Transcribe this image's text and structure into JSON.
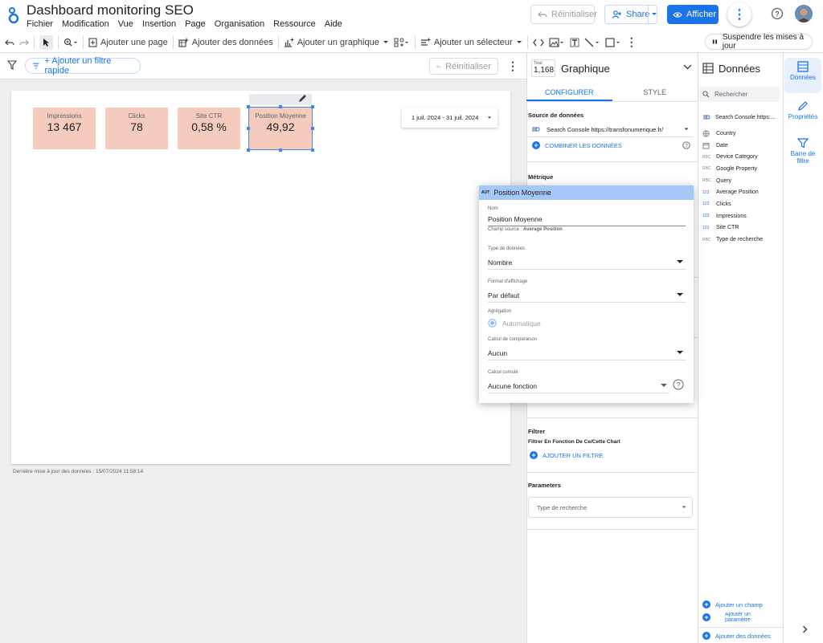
{
  "app": {
    "title": "Dashboard monitoring SEO",
    "menu": [
      "Fichier",
      "Modification",
      "Vue",
      "Insertion",
      "Page",
      "Organisation",
      "Ressource",
      "Aide"
    ],
    "reset_label": "Réinitialiser",
    "share_label": "Share",
    "view_label": "Afficher"
  },
  "toolbar": {
    "add_page": "Ajouter une page",
    "add_data": "Ajouter des données",
    "add_chart": "Ajouter un graphique",
    "add_selector": "Ajouter un sélecteur",
    "pause_updates": "Suspendre les mises à jour"
  },
  "filterbar": {
    "quick_filter": "+ Ajouter un filtre rapide",
    "reset": "Réinitialiser"
  },
  "canvas": {
    "scorecards": [
      {
        "label": "Impressions",
        "value": "13 467"
      },
      {
        "label": "Clicks",
        "value": "78"
      },
      {
        "label": "Site CTR",
        "value": "0,58 %"
      },
      {
        "label": "Position Moyenne",
        "value": "49,92"
      }
    ],
    "date_range": "1 juil. 2024 - 31 juil. 2024",
    "last_update": "Dernière mise à jour des données : 15/07/2024 11:58:14"
  },
  "properties": {
    "total_label": "Total",
    "total_value": "1,168",
    "title": "Graphique",
    "tab_configure": "CONFIGURER",
    "tab_style": "STYLE",
    "data_source_title": "Source de données",
    "data_source_value": "Search Console https://transfonumerique.fr/",
    "blend_data": "COMBINER LES DONNÉES",
    "metric_title": "Métrique",
    "filter_title": "Filtrer",
    "filter_subtitle": "Filtrer En Fonction De Ce/Cette Chart",
    "add_filter": "AJOUTER UN FILTRE",
    "parameters_title": "Parameters",
    "parameter_placeholder": "Type de recherche"
  },
  "field_card": {
    "type_badge": "AUT",
    "title": "Position Moyenne",
    "name_label": "Nom",
    "name_value": "Position Moyenne",
    "source_prefix": "Champ source : ",
    "source_field": "Average Position",
    "data_type_label": "Type de données",
    "data_type_value": "Nombre",
    "display_format_label": "Format d'affichage",
    "display_format_value": "Par défaut",
    "aggregation_label": "Agrégation",
    "aggregation_value": "Automatique",
    "comparison_label": "Calcul de comparaison",
    "comparison_value": "Aucun",
    "cumulative_label": "Calcul cumulé",
    "cumulative_value": "Aucune fonction"
  },
  "data_panel": {
    "title": "Données",
    "search_placeholder": "Rechercher",
    "source": "Search Console https:...",
    "fields": [
      {
        "type": "",
        "icon": "globe",
        "name": "Country"
      },
      {
        "type": "",
        "icon": "calendar",
        "name": "Date"
      },
      {
        "type": "RBC",
        "icon": "",
        "name": "Device Category"
      },
      {
        "type": "RBC",
        "icon": "",
        "name": "Google Property"
      },
      {
        "type": "RBC",
        "icon": "",
        "name": "Query"
      },
      {
        "type": "123",
        "icon": "",
        "name": "Average Position"
      },
      {
        "type": "123",
        "icon": "",
        "name": "Clicks"
      },
      {
        "type": "123",
        "icon": "",
        "name": "Impressions"
      },
      {
        "type": "123",
        "icon": "",
        "name": "Site CTR"
      },
      {
        "type": "RBC",
        "icon": "",
        "name": "Type de recherche"
      }
    ],
    "add_field": "Ajouter un champ",
    "add_parameter": "Ajouter un paramètre",
    "add_data": "Ajouter des données"
  },
  "rail": {
    "data": "Données",
    "properties": "Propriétés",
    "filter_bar": "Barre de filtre"
  },
  "colors": {
    "accent": "#1a73e8",
    "scorecard_bg": "#f4cbbc",
    "card_header": "#a5c8f8"
  }
}
